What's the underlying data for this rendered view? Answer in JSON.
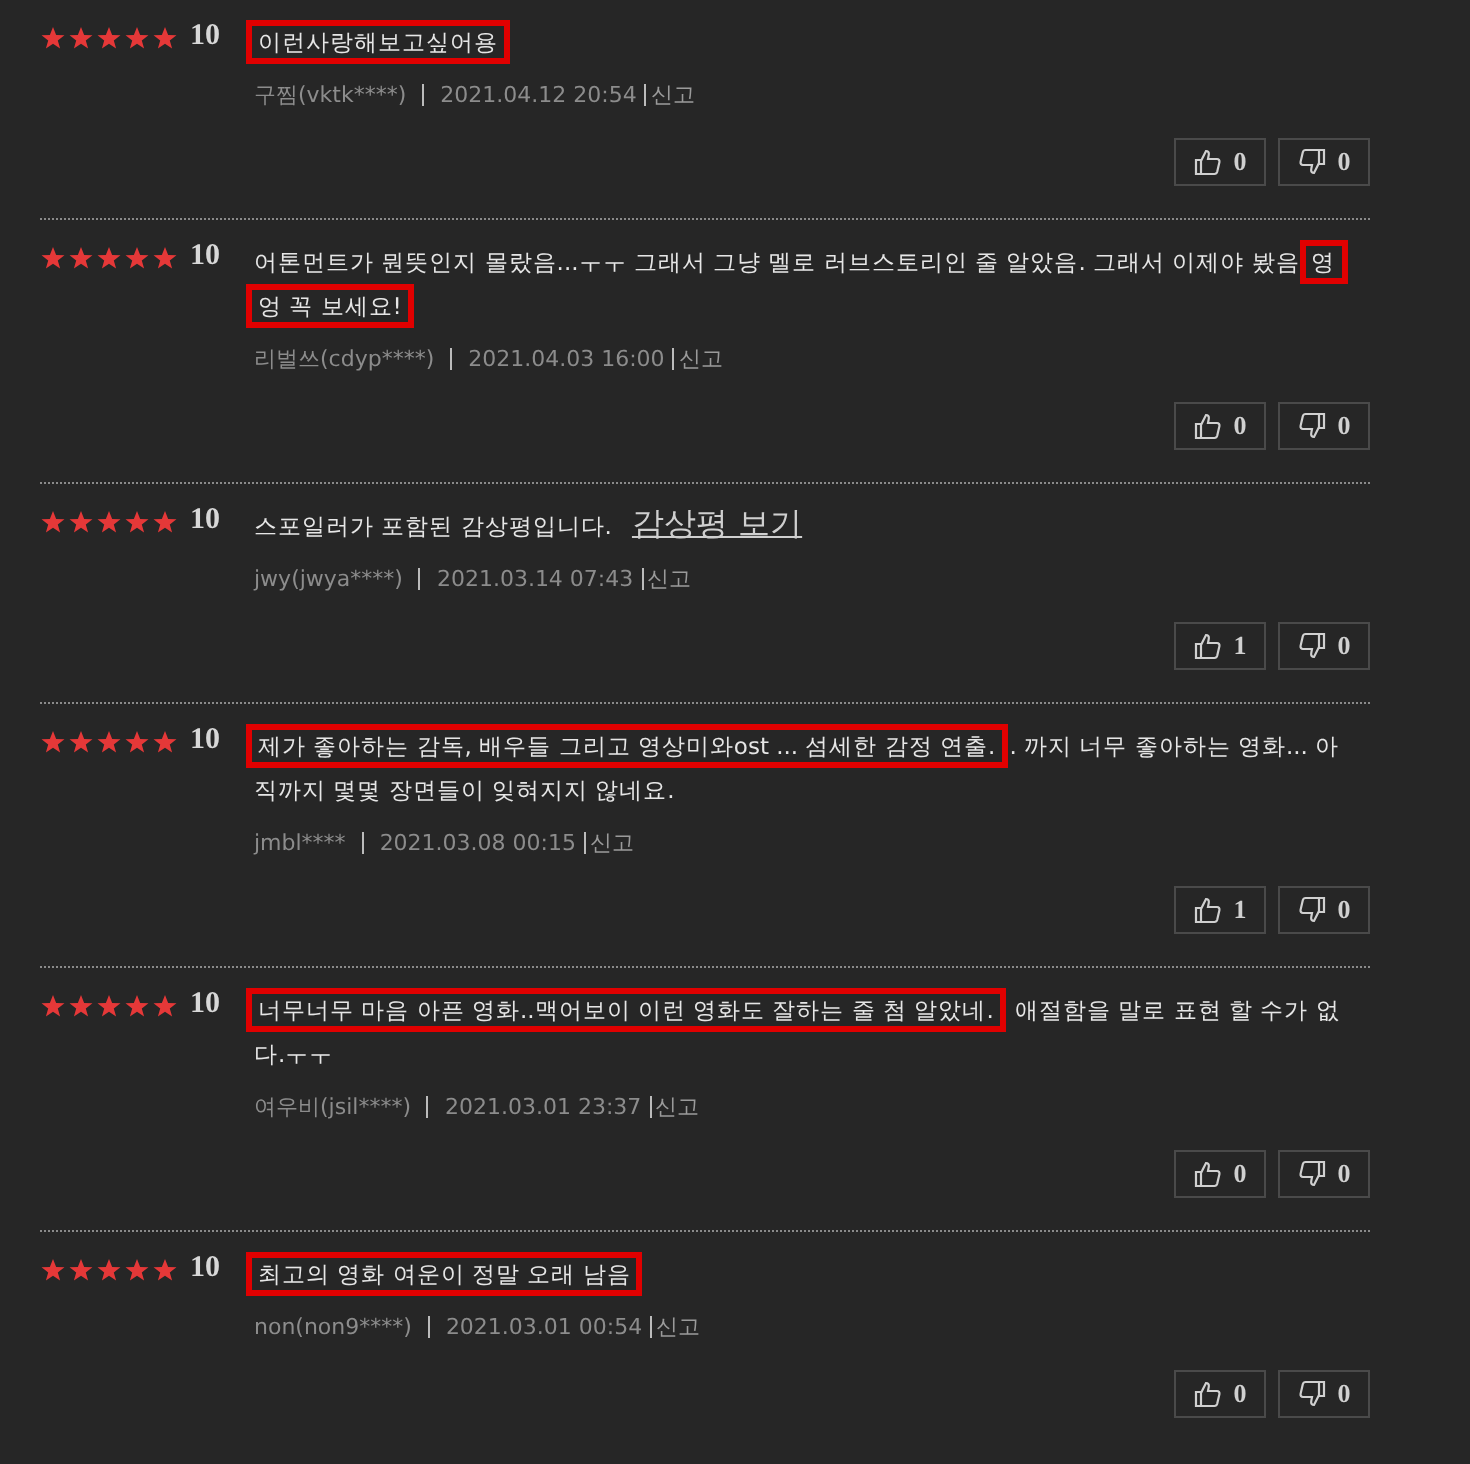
{
  "reviews": [
    {
      "stars": 5,
      "score": "10",
      "kind": "normal",
      "segments": [
        {
          "text": "이런사랑해보고싶어용",
          "highlighted": true
        }
      ],
      "nickname": "구찜(vktk****)",
      "date": "2021.04.12 20:54",
      "report": "신고",
      "likes": "0",
      "dislikes": "0"
    },
    {
      "stars": 5,
      "score": "10",
      "kind": "normal",
      "segments": [
        {
          "text": "어톤먼트가 뭔뜻인지 몰랐음...ㅜㅜ 그래서 그냥 멜로 러브스토리인 줄 알았음. 그래서 이제야 봤음 ",
          "highlighted": false
        },
        {
          "text": "영엉 꼭 보세요!",
          "highlighted": true
        }
      ],
      "nickname": "리벌쓰(cdyp****)",
      "date": "2021.04.03 16:00",
      "report": "신고",
      "likes": "0",
      "dislikes": "0"
    },
    {
      "stars": 5,
      "score": "10",
      "kind": "spoiler",
      "segments": [
        {
          "text": "스포일러가 포함된 감상평입니다.",
          "highlighted": false
        }
      ],
      "link": "감상평 보기",
      "nickname": "jwy(jwya****)",
      "date": "2021.03.14 07:43",
      "report": "신고",
      "likes": "1",
      "dislikes": "0"
    },
    {
      "stars": 5,
      "score": "10",
      "kind": "normal",
      "segments": [
        {
          "text": "제가 좋아하는 감독, 배우들 그리고 영상미와ost ... 섬세한 감정 연출.",
          "highlighted": true
        },
        {
          "text": ". 까지 너무 좋아하는 영화... 아직까지 몇몇 장면들이 잊혀지지 않네요.",
          "highlighted": false
        }
      ],
      "nickname": "jmbl****",
      "date": "2021.03.08 00:15",
      "report": "신고",
      "likes": "1",
      "dislikes": "0"
    },
    {
      "stars": 5,
      "score": "10",
      "kind": "normal",
      "segments": [
        {
          "text": "너무너무 마음 아픈 영화..맥어보이 이런 영화도 잘하는 줄 첨 알았네.",
          "highlighted": true
        },
        {
          "text": " 애절함을 말로 표현 할 수가 없다.ㅜㅜ",
          "highlighted": false
        }
      ],
      "nickname": "여우비(jsil****)",
      "date": "2021.03.01 23:37",
      "report": "신고",
      "likes": "0",
      "dislikes": "0"
    },
    {
      "stars": 5,
      "score": "10",
      "kind": "normal",
      "segments": [
        {
          "text": "최고의 영화 여운이 정말 오래 남음",
          "highlighted": true
        }
      ],
      "nickname": "non(non9****)",
      "date": "2021.03.01 00:54",
      "report": "신고",
      "likes": "0",
      "dislikes": "0"
    }
  ]
}
